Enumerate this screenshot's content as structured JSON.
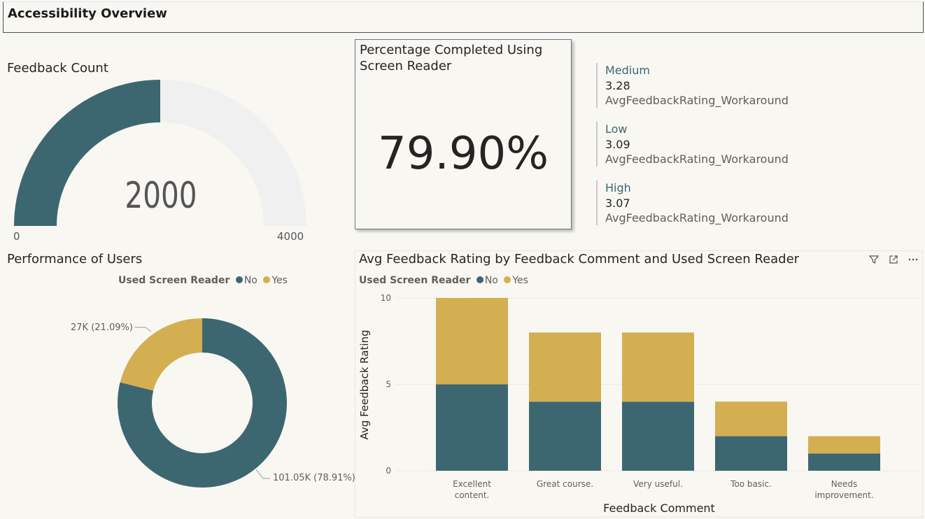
{
  "header": {
    "title": "Accessibility Overview"
  },
  "gauge": {
    "title": "Feedback Count",
    "value": "2000",
    "min": "0",
    "max": "4000",
    "value_num": 2000,
    "min_num": 0,
    "max_num": 4000,
    "fill_color": "#3d6770",
    "track_color": "#f0f0f0"
  },
  "kpi": {
    "title": "Percentage Completed Using Screen Reader",
    "value": "79.90%"
  },
  "multi_row": [
    {
      "category": "Medium",
      "value": "3.28",
      "label": "AvgFeedbackRating_Workaround"
    },
    {
      "category": "Low",
      "value": "3.09",
      "label": "AvgFeedbackRating_Workaround"
    },
    {
      "category": "High",
      "value": "3.07",
      "label": "AvgFeedbackRating_Workaround"
    }
  ],
  "donut": {
    "title": "Performance of Users",
    "legend_title": "Used Screen Reader",
    "legend": [
      {
        "name": "No",
        "color": "#3d6770"
      },
      {
        "name": "Yes",
        "color": "#d4af52"
      }
    ],
    "label_yes": "27K (21.09%)",
    "label_no": "101.05K (78.91%)"
  },
  "bar_chart": {
    "title": "Avg Feedback Rating by Feedback Comment and Used Screen Reader",
    "legend_title": "Used Screen Reader",
    "legend": [
      {
        "name": "No",
        "color": "#3d6770"
      },
      {
        "name": "Yes",
        "color": "#d4af52"
      }
    ],
    "ytick_labels": [
      "10",
      "5",
      "0"
    ],
    "icons": [
      "filter-icon",
      "focus-mode-icon",
      "more-options-icon"
    ]
  },
  "chart_data": [
    {
      "type": "pie",
      "title": "Performance of Users",
      "categories": [
        "No",
        "Yes"
      ],
      "values": [
        101050,
        27000
      ],
      "labels": [
        "101.05K (78.91%)",
        "27K (21.09%)"
      ],
      "legend_title": "Used Screen Reader",
      "legend_position": "top"
    },
    {
      "type": "bar",
      "stacked": true,
      "title": "Avg Feedback Rating by Feedback Comment and Used Screen Reader",
      "categories": [
        "Excellent content.",
        "Great course.",
        "Very useful.",
        "Too basic.",
        "Needs improvement."
      ],
      "series": [
        {
          "name": "No",
          "values": [
            5,
            4,
            4,
            2,
            1
          ]
        },
        {
          "name": "Yes",
          "values": [
            5,
            4,
            4,
            2,
            1
          ]
        }
      ],
      "xlabel": "Feedback Comment",
      "ylabel": "Avg Feedback Rating",
      "ylim": [
        0,
        10
      ],
      "yticks": [
        0,
        5,
        10
      ],
      "grid": true,
      "legend_position": "top-left"
    }
  ]
}
